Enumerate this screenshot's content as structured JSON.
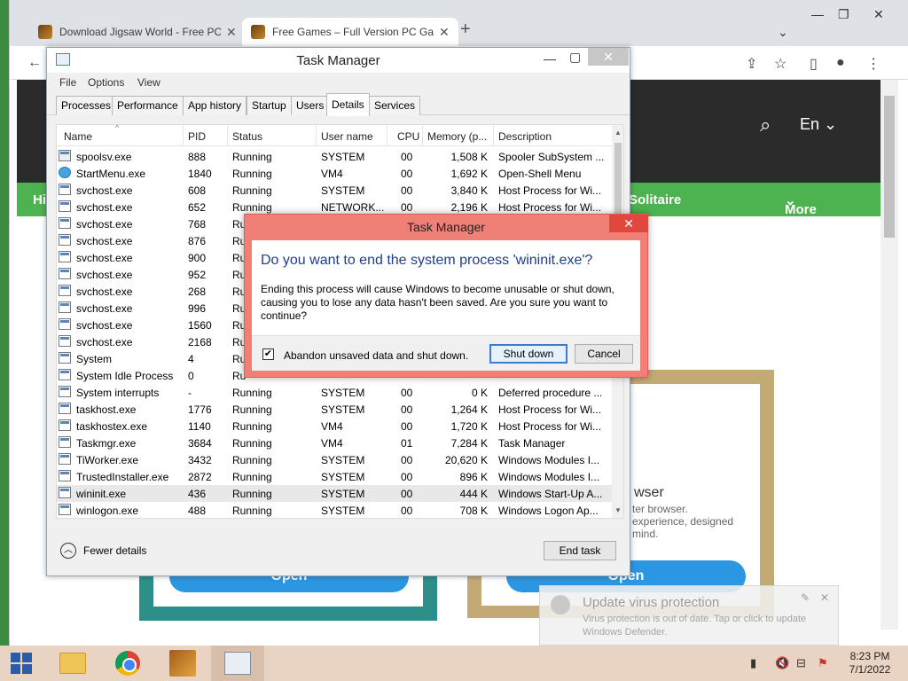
{
  "browser": {
    "tabs": [
      {
        "title": "Download Jigsaw World - Free PC"
      },
      {
        "title": "Free Games – Full Version PC Ga"
      }
    ],
    "site": {
      "lang": "En",
      "nav": [
        "Hi",
        "Solitaire",
        "More"
      ],
      "open_label": "Open",
      "browser_heading": "wser",
      "browser_desc": "ter browser.\n experience, designed\nmind."
    }
  },
  "task_manager": {
    "title": "Task Manager",
    "menu": [
      "File",
      "Options",
      "View"
    ],
    "tabs": [
      "Processes",
      "Performance",
      "App history",
      "Startup",
      "Users",
      "Details",
      "Services"
    ],
    "active_tab": "Details",
    "columns": [
      "Name",
      "PID",
      "Status",
      "User name",
      "CPU",
      "Memory (p...",
      "Description"
    ],
    "rows": [
      {
        "icon": "printer-icon",
        "name": "spoolsv.exe",
        "pid": "888",
        "status": "Running",
        "user": "SYSTEM",
        "cpu": "00",
        "mem": "1,508 K",
        "desc": "Spooler SubSystem ..."
      },
      {
        "icon": "startmenu-icon",
        "name": "StartMenu.exe",
        "pid": "1840",
        "status": "Running",
        "user": "VM4",
        "cpu": "00",
        "mem": "1,692 K",
        "desc": "Open-Shell Menu"
      },
      {
        "icon": "process-icon",
        "name": "svchost.exe",
        "pid": "608",
        "status": "Running",
        "user": "SYSTEM",
        "cpu": "00",
        "mem": "3,840 K",
        "desc": "Host Process for Wi..."
      },
      {
        "icon": "process-icon",
        "name": "svchost.exe",
        "pid": "652",
        "status": "Running",
        "user": "NETWORK...",
        "cpu": "00",
        "mem": "2,196 K",
        "desc": "Host Process for Wi..."
      },
      {
        "icon": "process-icon",
        "name": "svchost.exe",
        "pid": "768",
        "status": "Ru",
        "user": "",
        "cpu": "",
        "mem": "",
        "desc": ""
      },
      {
        "icon": "process-icon",
        "name": "svchost.exe",
        "pid": "876",
        "status": "Ru",
        "user": "",
        "cpu": "",
        "mem": "",
        "desc": ""
      },
      {
        "icon": "process-icon",
        "name": "svchost.exe",
        "pid": "900",
        "status": "Ru",
        "user": "",
        "cpu": "",
        "mem": "",
        "desc": ""
      },
      {
        "icon": "process-icon",
        "name": "svchost.exe",
        "pid": "952",
        "status": "Ru",
        "user": "",
        "cpu": "",
        "mem": "",
        "desc": ""
      },
      {
        "icon": "process-icon",
        "name": "svchost.exe",
        "pid": "268",
        "status": "Ru",
        "user": "",
        "cpu": "",
        "mem": "",
        "desc": ""
      },
      {
        "icon": "process-icon",
        "name": "svchost.exe",
        "pid": "996",
        "status": "Ru",
        "user": "",
        "cpu": "",
        "mem": "",
        "desc": ""
      },
      {
        "icon": "process-icon",
        "name": "svchost.exe",
        "pid": "1560",
        "status": "Ru",
        "user": "",
        "cpu": "",
        "mem": "",
        "desc": ""
      },
      {
        "icon": "process-icon",
        "name": "svchost.exe",
        "pid": "2168",
        "status": "Ru",
        "user": "",
        "cpu": "",
        "mem": "",
        "desc": ""
      },
      {
        "icon": "process-icon",
        "name": "System",
        "pid": "4",
        "status": "Ru",
        "user": "",
        "cpu": "",
        "mem": "",
        "desc": ""
      },
      {
        "icon": "process-icon",
        "name": "System Idle Process",
        "pid": "0",
        "status": "Ru",
        "user": "",
        "cpu": "",
        "mem": "",
        "desc": ""
      },
      {
        "icon": "process-icon",
        "name": "System interrupts",
        "pid": "-",
        "status": "Running",
        "user": "SYSTEM",
        "cpu": "00",
        "mem": "0 K",
        "desc": "Deferred procedure ..."
      },
      {
        "icon": "process-icon",
        "name": "taskhost.exe",
        "pid": "1776",
        "status": "Running",
        "user": "SYSTEM",
        "cpu": "00",
        "mem": "1,264 K",
        "desc": "Host Process for Wi..."
      },
      {
        "icon": "process-icon",
        "name": "taskhostex.exe",
        "pid": "1140",
        "status": "Running",
        "user": "VM4",
        "cpu": "00",
        "mem": "1,720 K",
        "desc": "Host Process for Wi..."
      },
      {
        "icon": "taskmgr-icon",
        "name": "Taskmgr.exe",
        "pid": "3684",
        "status": "Running",
        "user": "VM4",
        "cpu": "01",
        "mem": "7,284 K",
        "desc": "Task Manager"
      },
      {
        "icon": "process-icon",
        "name": "TiWorker.exe",
        "pid": "3432",
        "status": "Running",
        "user": "SYSTEM",
        "cpu": "00",
        "mem": "20,620 K",
        "desc": "Windows Modules I..."
      },
      {
        "icon": "process-icon",
        "name": "TrustedInstaller.exe",
        "pid": "2872",
        "status": "Running",
        "user": "SYSTEM",
        "cpu": "00",
        "mem": "896 K",
        "desc": "Windows Modules I..."
      },
      {
        "icon": "process-icon",
        "name": "wininit.exe",
        "pid": "436",
        "status": "Running",
        "user": "SYSTEM",
        "cpu": "00",
        "mem": "444 K",
        "desc": "Windows Start-Up A...",
        "selected": true
      },
      {
        "icon": "process-icon",
        "name": "winlogon.exe",
        "pid": "488",
        "status": "Running",
        "user": "SYSTEM",
        "cpu": "00",
        "mem": "708 K",
        "desc": "Windows Logon Ap..."
      }
    ],
    "fewer_details": "Fewer details",
    "end_task": "End task"
  },
  "dialog": {
    "title": "Task Manager",
    "question": "Do you want to end the system process 'wininit.exe'?",
    "message": "Ending this process will cause Windows to become unusable or shut down, causing you to lose any data hasn't been saved. Are you sure you want to continue?",
    "checkbox_label": "Abandon unsaved data and shut down.",
    "checkbox_checked": true,
    "confirm": "Shut down",
    "cancel": "Cancel"
  },
  "toast": {
    "title": "Update virus protection",
    "body": "Virus protection is out of date. Tap or click to update Windows Defender."
  },
  "taskbar": {
    "time": "8:23 PM",
    "date": "7/1/2022"
  }
}
